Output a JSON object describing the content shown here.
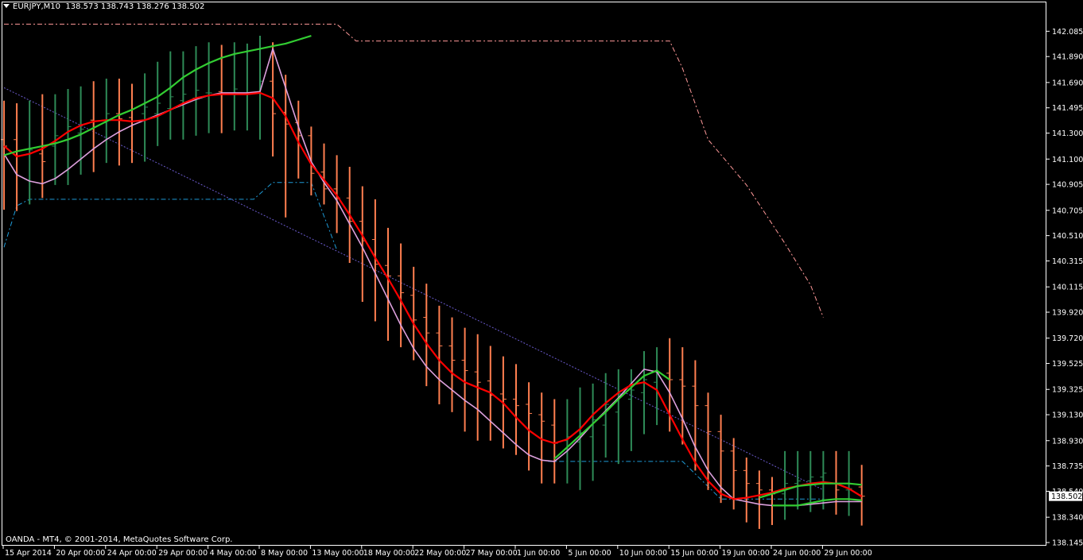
{
  "chart_header": {
    "symbol": "EURJPY,M10",
    "ohlc": "138.573 138.743 138.276 138.502"
  },
  "footer": {
    "copyright": "OANDA - MT4, © 2001-2014, MetaQuotes Software Corp."
  },
  "colors": {
    "background": "#000000",
    "frame": "#ffffff",
    "bull_bar": "#2e8b57",
    "bear_bar": "#ff7f50",
    "ma_fast": "#ff0000",
    "ma_green": "#32cd32",
    "ma_pink": "#dda0dd",
    "upper_band": "#ff9999",
    "lower_band": "#1e9ad6",
    "trendline": "#6a5acd",
    "price_label_bg": "#ffffff",
    "price_label_text": "#000000"
  },
  "chart_data": {
    "type": "bar",
    "ylim": [
      138.145,
      142.185
    ],
    "price_ticks": [
      "142.085",
      "141.890",
      "141.690",
      "141.495",
      "141.300",
      "141.100",
      "140.905",
      "140.705",
      "140.510",
      "140.315",
      "140.115",
      "139.920",
      "139.720",
      "139.525",
      "139.325",
      "139.130",
      "138.930",
      "138.735",
      "138.540",
      "138.340",
      "138.145"
    ],
    "price_tick_values": [
      142.085,
      141.89,
      141.69,
      141.495,
      141.3,
      141.1,
      140.905,
      140.705,
      140.51,
      140.315,
      140.115,
      139.92,
      139.72,
      139.525,
      139.325,
      139.13,
      138.93,
      138.735,
      138.54,
      138.34,
      138.145
    ],
    "current_price": "138.502",
    "current_price_value": 138.502,
    "time_labels": [
      {
        "label": "15 Apr 2014",
        "index": 0
      },
      {
        "label": "20 Apr 00:00",
        "index": 4
      },
      {
        "label": "24 Apr 00:00",
        "index": 8
      },
      {
        "label": "29 Apr 00:00",
        "index": 12
      },
      {
        "label": "4 May 00:00",
        "index": 16
      },
      {
        "label": "8 May 00:00",
        "index": 20
      },
      {
        "label": "13 May 00:00",
        "index": 24
      },
      {
        "label": "18 May 00:00",
        "index": 28
      },
      {
        "label": "22 May 00:00",
        "index": 32
      },
      {
        "label": "27 May 00:00",
        "index": 36
      },
      {
        "label": "1 Jun 00:00",
        "index": 40
      },
      {
        "label": "5 Jun 00:00",
        "index": 44
      },
      {
        "label": "10 Jun 00:00",
        "index": 48
      },
      {
        "label": "15 Jun 00:00",
        "index": 52
      },
      {
        "label": "19 Jun 00:00",
        "index": 56
      },
      {
        "label": "24 Jun 00:00",
        "index": 60
      },
      {
        "label": "29 Jun 00:00",
        "index": 64
      }
    ],
    "bars": [
      {
        "o": 141.25,
        "h": 141.55,
        "l": 140.71,
        "c": 141.2
      },
      {
        "o": 141.25,
        "h": 141.53,
        "l": 140.7,
        "c": 141.12
      },
      {
        "o": 141.14,
        "h": 141.55,
        "l": 140.75,
        "c": 141.17
      },
      {
        "o": 141.14,
        "h": 141.6,
        "l": 140.8,
        "c": 141.08
      },
      {
        "o": 141.2,
        "h": 141.6,
        "l": 140.9,
        "c": 141.28
      },
      {
        "o": 141.25,
        "h": 141.64,
        "l": 140.9,
        "c": 141.35
      },
      {
        "o": 141.3,
        "h": 141.66,
        "l": 140.98,
        "c": 141.33
      },
      {
        "o": 141.4,
        "h": 141.7,
        "l": 141.0,
        "c": 141.39
      },
      {
        "o": 141.38,
        "h": 141.72,
        "l": 141.07,
        "c": 141.45
      },
      {
        "o": 141.45,
        "h": 141.72,
        "l": 141.05,
        "c": 141.41
      },
      {
        "o": 141.42,
        "h": 141.68,
        "l": 141.07,
        "c": 141.39
      },
      {
        "o": 141.45,
        "h": 141.76,
        "l": 141.08,
        "c": 141.5
      },
      {
        "o": 141.45,
        "h": 141.85,
        "l": 141.2,
        "c": 141.53
      },
      {
        "o": 141.49,
        "h": 141.93,
        "l": 141.25,
        "c": 141.58
      },
      {
        "o": 141.55,
        "h": 141.93,
        "l": 141.25,
        "c": 141.6
      },
      {
        "o": 141.57,
        "h": 141.97,
        "l": 141.28,
        "c": 141.63
      },
      {
        "o": 141.61,
        "h": 142.0,
        "l": 141.3,
        "c": 141.61
      },
      {
        "o": 141.62,
        "h": 141.98,
        "l": 141.3,
        "c": 141.61
      },
      {
        "o": 141.6,
        "h": 142.0,
        "l": 141.32,
        "c": 141.64
      },
      {
        "o": 141.61,
        "h": 141.99,
        "l": 141.32,
        "c": 141.61
      },
      {
        "o": 141.61,
        "h": 142.05,
        "l": 141.25,
        "c": 141.7
      },
      {
        "o": 141.7,
        "h": 142.0,
        "l": 141.12,
        "c": 141.45
      },
      {
        "o": 141.46,
        "h": 141.75,
        "l": 140.65,
        "c": 141.37
      },
      {
        "o": 141.38,
        "h": 141.55,
        "l": 140.95,
        "c": 141.28
      },
      {
        "o": 141.28,
        "h": 141.35,
        "l": 140.82,
        "c": 140.99
      },
      {
        "o": 141.0,
        "h": 141.22,
        "l": 140.75,
        "c": 140.87
      },
      {
        "o": 140.87,
        "h": 141.13,
        "l": 140.53,
        "c": 140.8
      },
      {
        "o": 140.8,
        "h": 141.04,
        "l": 140.3,
        "c": 140.62
      },
      {
        "o": 140.62,
        "h": 140.89,
        "l": 140.0,
        "c": 140.47
      },
      {
        "o": 140.48,
        "h": 140.79,
        "l": 139.85,
        "c": 140.29
      },
      {
        "o": 140.28,
        "h": 140.57,
        "l": 139.7,
        "c": 140.2
      },
      {
        "o": 140.2,
        "h": 140.45,
        "l": 139.65,
        "c": 140.07
      },
      {
        "o": 140.05,
        "h": 140.27,
        "l": 139.55,
        "c": 139.86
      },
      {
        "o": 139.88,
        "h": 140.14,
        "l": 139.35,
        "c": 139.76
      },
      {
        "o": 139.76,
        "h": 139.97,
        "l": 139.21,
        "c": 139.66
      },
      {
        "o": 139.66,
        "h": 139.88,
        "l": 139.15,
        "c": 139.55
      },
      {
        "o": 139.55,
        "h": 139.8,
        "l": 139.0,
        "c": 139.47
      },
      {
        "o": 139.46,
        "h": 139.75,
        "l": 138.93,
        "c": 139.38
      },
      {
        "o": 139.39,
        "h": 139.66,
        "l": 138.93,
        "c": 139.28
      },
      {
        "o": 139.29,
        "h": 139.58,
        "l": 138.87,
        "c": 139.25
      },
      {
        "o": 139.25,
        "h": 139.52,
        "l": 138.82,
        "c": 139.2
      },
      {
        "o": 139.21,
        "h": 139.38,
        "l": 138.7,
        "c": 139.14
      },
      {
        "o": 139.13,
        "h": 139.3,
        "l": 138.6,
        "c": 139.08
      },
      {
        "o": 139.05,
        "h": 139.25,
        "l": 138.6,
        "c": 138.91
      },
      {
        "o": 138.93,
        "h": 139.25,
        "l": 138.6,
        "c": 138.96
      },
      {
        "o": 138.92,
        "h": 139.34,
        "l": 138.55,
        "c": 138.99
      },
      {
        "o": 138.96,
        "h": 139.37,
        "l": 138.62,
        "c": 139.09
      },
      {
        "o": 139.05,
        "h": 139.45,
        "l": 138.8,
        "c": 139.21
      },
      {
        "o": 139.15,
        "h": 139.48,
        "l": 138.75,
        "c": 139.29
      },
      {
        "o": 139.25,
        "h": 139.48,
        "l": 138.85,
        "c": 139.32
      },
      {
        "o": 139.3,
        "h": 139.62,
        "l": 138.98,
        "c": 139.4
      },
      {
        "o": 139.38,
        "h": 139.65,
        "l": 139.05,
        "c": 139.45
      },
      {
        "o": 139.45,
        "h": 139.72,
        "l": 139.0,
        "c": 139.4
      },
      {
        "o": 139.4,
        "h": 139.65,
        "l": 138.9,
        "c": 139.35
      },
      {
        "o": 139.35,
        "h": 139.55,
        "l": 138.7,
        "c": 139.2
      },
      {
        "o": 139.2,
        "h": 139.3,
        "l": 138.55,
        "c": 139.0
      },
      {
        "o": 139.0,
        "h": 139.13,
        "l": 138.45,
        "c": 138.85
      },
      {
        "o": 138.85,
        "h": 138.95,
        "l": 138.4,
        "c": 138.7
      },
      {
        "o": 138.7,
        "h": 138.8,
        "l": 138.3,
        "c": 138.6
      },
      {
        "o": 138.6,
        "h": 138.7,
        "l": 138.25,
        "c": 138.55
      },
      {
        "o": 138.55,
        "h": 138.65,
        "l": 138.28,
        "c": 138.52
      },
      {
        "o": 138.52,
        "h": 138.85,
        "l": 138.32,
        "c": 138.6
      },
      {
        "o": 138.6,
        "h": 138.85,
        "l": 138.4,
        "c": 138.62
      },
      {
        "o": 138.62,
        "h": 138.85,
        "l": 138.38,
        "c": 138.65
      },
      {
        "o": 138.65,
        "h": 138.85,
        "l": 138.4,
        "c": 138.68
      },
      {
        "o": 138.6,
        "h": 138.85,
        "l": 138.36,
        "c": 138.55
      },
      {
        "o": 138.55,
        "h": 138.85,
        "l": 138.35,
        "c": 138.56
      },
      {
        "o": 138.573,
        "h": 138.743,
        "l": 138.276,
        "c": 138.502
      }
    ],
    "series": [
      {
        "key": "ma_fast",
        "values": [
          141.2,
          141.12,
          141.14,
          141.18,
          141.24,
          141.31,
          141.36,
          141.39,
          141.4,
          141.4,
          141.39,
          141.4,
          141.43,
          141.48,
          141.53,
          141.57,
          141.59,
          141.6,
          141.6,
          141.6,
          141.61,
          141.57,
          141.43,
          141.23,
          141.06,
          140.94,
          140.82,
          140.67,
          140.51,
          140.34,
          140.18,
          140.01,
          139.83,
          139.68,
          139.55,
          139.45,
          139.38,
          139.34,
          139.3,
          139.22,
          139.11,
          139.01,
          138.94,
          138.91,
          138.94,
          139.02,
          139.13,
          139.22,
          139.3,
          139.36,
          139.38,
          139.32,
          139.13,
          138.94,
          138.76,
          138.62,
          138.52,
          138.48,
          138.49,
          138.51,
          138.53,
          138.56,
          138.58,
          138.6,
          138.61,
          138.6,
          138.56,
          138.5
        ]
      },
      {
        "key": "ma_green",
        "values": [
          141.13,
          141.16,
          141.18,
          141.2,
          141.22,
          141.25,
          141.29,
          141.34,
          141.39,
          141.44,
          141.48,
          141.53,
          141.58,
          141.65,
          141.73,
          141.79,
          141.84,
          141.88,
          141.91,
          141.93,
          141.95,
          141.97,
          141.99,
          142.02,
          142.05,
          null,
          null,
          null,
          null,
          null,
          null,
          null,
          null,
          null,
          null,
          null,
          null,
          null,
          null,
          null,
          null,
          null,
          null,
          138.79,
          138.88,
          138.97,
          139.06,
          139.15,
          139.25,
          139.34,
          139.43,
          139.47,
          139.4,
          null,
          null,
          null,
          null,
          null,
          null,
          138.49,
          138.52,
          138.55,
          138.58,
          138.59,
          138.6,
          138.6,
          138.6,
          138.59
        ]
      },
      {
        "key": "ma_green2",
        "values": [
          null,
          null,
          null,
          null,
          null,
          null,
          null,
          null,
          null,
          null,
          null,
          null,
          null,
          null,
          null,
          null,
          null,
          null,
          null,
          null,
          null,
          null,
          null,
          null,
          null,
          null,
          null,
          null,
          null,
          null,
          null,
          null,
          null,
          null,
          null,
          null,
          null,
          null,
          null,
          null,
          null,
          null,
          null,
          null,
          null,
          null,
          null,
          null,
          null,
          null,
          null,
          null,
          null,
          null,
          null,
          null,
          null,
          null,
          null,
          null,
          138.43,
          138.43,
          138.43,
          138.45,
          138.47,
          138.48,
          138.48,
          138.47
        ]
      },
      {
        "key": "ma_pink",
        "values": [
          141.14,
          140.98,
          140.93,
          140.91,
          140.95,
          141.02,
          141.1,
          141.18,
          141.25,
          141.31,
          141.36,
          141.4,
          141.44,
          141.48,
          141.52,
          141.56,
          141.59,
          141.61,
          141.61,
          141.61,
          141.62,
          141.95,
          141.65,
          141.35,
          141.08,
          140.92,
          140.78,
          140.6,
          140.42,
          140.22,
          140.02,
          139.82,
          139.64,
          139.5,
          139.4,
          139.32,
          139.24,
          139.17,
          139.08,
          138.99,
          138.9,
          138.82,
          138.78,
          138.77,
          138.85,
          138.95,
          139.06,
          139.16,
          139.26,
          139.37,
          139.48,
          139.46,
          139.3,
          139.1,
          138.88,
          138.7,
          138.57,
          138.48,
          138.46,
          138.44,
          138.43,
          138.43,
          138.43,
          138.44,
          138.45,
          138.46,
          138.46,
          138.46
        ]
      }
    ],
    "upper_band": [
      [
        0,
        142.14
      ],
      [
        26,
        142.14
      ],
      [
        27.5,
        142.01
      ],
      [
        52,
        142.01
      ],
      [
        53,
        141.8
      ],
      [
        55,
        141.25
      ],
      [
        58,
        140.9
      ],
      [
        61,
        140.45
      ],
      [
        63,
        140.13
      ],
      [
        64,
        139.88
      ]
    ],
    "lower_band": [
      [
        0,
        140.42
      ],
      [
        1,
        140.74
      ],
      [
        2,
        140.79
      ],
      [
        19.5,
        140.79
      ],
      [
        21,
        140.92
      ],
      [
        24,
        140.92
      ],
      [
        26,
        140.4
      ]
    ],
    "lower_band_2": [
      [
        42.5,
        138.77
      ],
      [
        53,
        138.77
      ],
      [
        56,
        138.48
      ],
      [
        64,
        138.48
      ]
    ],
    "trendline": [
      [
        0,
        141.65
      ],
      [
        64,
        138.55
      ]
    ]
  }
}
